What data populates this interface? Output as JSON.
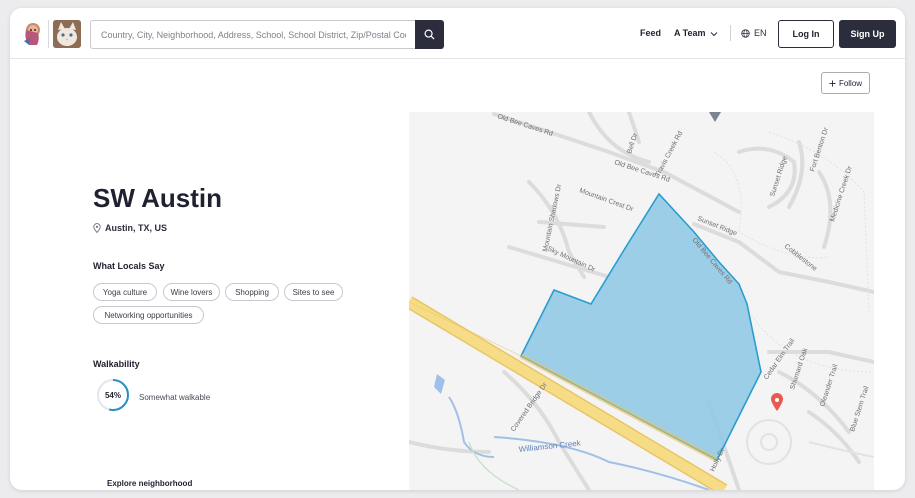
{
  "header": {
    "search_placeholder": "Country, City, Neighborhood, Address, School, School District, Zip/Postal Code",
    "nav": {
      "feed": "Feed",
      "team": "A Team",
      "language": "EN",
      "login": "Log In",
      "signup": "Sign Up"
    }
  },
  "follow_label": "Follow",
  "neighborhood": {
    "title": "SW Austin",
    "location": "Austin, TX, US"
  },
  "locals": {
    "heading": "What Locals Say",
    "tags": [
      "Yoga culture",
      "Wine lovers",
      "Shopping",
      "Sites to see",
      "Networking opportunities"
    ]
  },
  "walkability": {
    "heading": "Walkability",
    "score_label": "54%",
    "score": 54,
    "description": "Somewhat walkable"
  },
  "explore_heading": "Explore neighborhood",
  "map": {
    "streets": [
      "Old Bee Caves Rd",
      "Old Bee Caves Rd",
      "Travis Creek Rd",
      "Bell Dr",
      "Mountain Shadows Dr",
      "Mountain Crest Dr",
      "Sky Mountain Dr",
      "Sunset Ridge",
      "Old Bee Caves Rd",
      "Sunset Ridge",
      "Fort Benton Dr",
      "Medicine Creek Dr",
      "Cobblestone",
      "Cedar Elm Trail",
      "Shumard Oak",
      "Oleander Trail",
      "Blue Stem Trail",
      "Covered Bridge Dr",
      "Williamson Creek",
      "Holly Dr"
    ],
    "area_color": "#8fc8e6",
    "area_stroke": "#2a9dd1",
    "highway_color": "#f2d27a"
  },
  "colors": {
    "primary": "#2b2d3d",
    "walk_ring": "#2a8fc7"
  }
}
